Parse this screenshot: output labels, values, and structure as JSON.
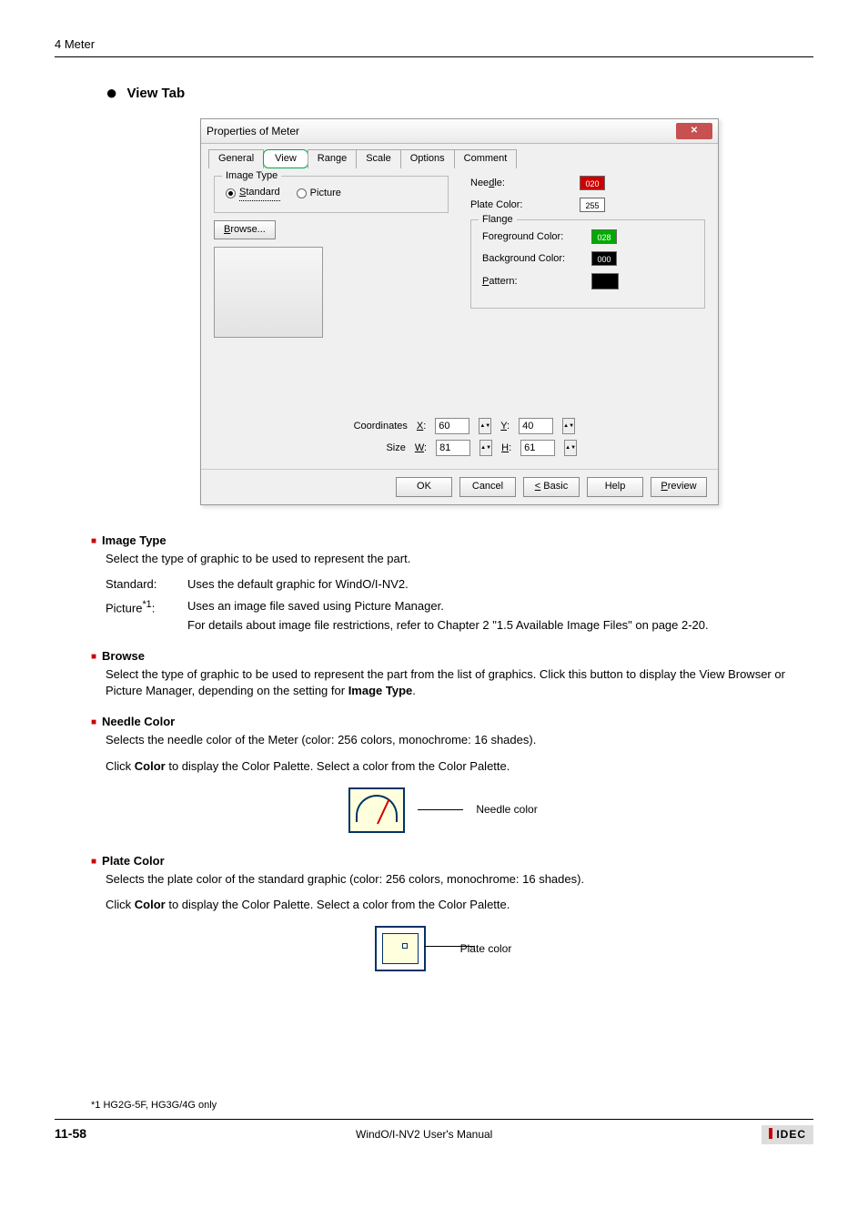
{
  "chapter": "4 Meter",
  "tab_heading": "View",
  "tab_heading_suffix": " Tab",
  "dialog": {
    "title": "Properties of Meter",
    "tabs": [
      "General",
      "View",
      "Range",
      "Scale",
      "Options",
      "Comment"
    ],
    "active_tab": "View",
    "image_type": {
      "legend": "Image Type",
      "standard": "Standard",
      "picture": "Picture"
    },
    "browse": "Browse...",
    "needle_label": "Needle:",
    "needle_color": "020",
    "plate_color_label": "Plate Color:",
    "plate_color": "255",
    "flange": {
      "legend": "Flange",
      "fg_label": "Foreground Color:",
      "fg": "028",
      "bg_label": "Background Color:",
      "bg": "000",
      "pattern_label": "Pattern:"
    },
    "coords": {
      "label": "Coordinates",
      "x_label": "X:",
      "x": "60",
      "y_label": "Y:",
      "y": "40"
    },
    "size": {
      "label": "Size",
      "w_label": "W:",
      "w": "81",
      "h_label": "H:",
      "h": "61"
    },
    "buttons": {
      "ok": "OK",
      "cancel": "Cancel",
      "basic": "< Basic",
      "help": "Help",
      "preview": "Preview"
    }
  },
  "sections": {
    "image_type": {
      "title": "Image Type",
      "desc": "Select the type of graphic to be used to represent the part.",
      "rows": [
        {
          "term": "Standard:",
          "desc": "Uses the default graphic for WindO/I-NV2."
        },
        {
          "term": "Picture*1:",
          "desc": "Uses an image file saved using Picture Manager.",
          "sub": "For details about image file restrictions, refer to Chapter 2 \"1.5 Available Image Files\" on page 2-20."
        }
      ]
    },
    "browse": {
      "title": "Browse",
      "desc": "Select the type of graphic to be used to represent the part from the list of graphics. Click this button to display the View Browser or Picture Manager, depending on the setting for Image Type."
    },
    "needle_color": {
      "title": "Needle Color",
      "l1": "Selects the needle color of the Meter (color: 256 colors, monochrome: 16 shades).",
      "l2": "Click Color to display the Color Palette. Select a color from the Color Palette.",
      "fig_label": "Needle color"
    },
    "plate_color": {
      "title": "Plate Color",
      "l1": "Selects the plate color of the standard graphic (color: 256 colors, monochrome: 16 shades).",
      "l2": "Click Color to display the Color Palette. Select a color from the Color Palette.",
      "fig_label": "Plate color"
    }
  },
  "footnote": "*1 HG2G-5F, HG3G/4G only",
  "footer": {
    "page": "11-58",
    "center": "WindO/I-NV2 User's Manual",
    "brand": "IDEC"
  }
}
